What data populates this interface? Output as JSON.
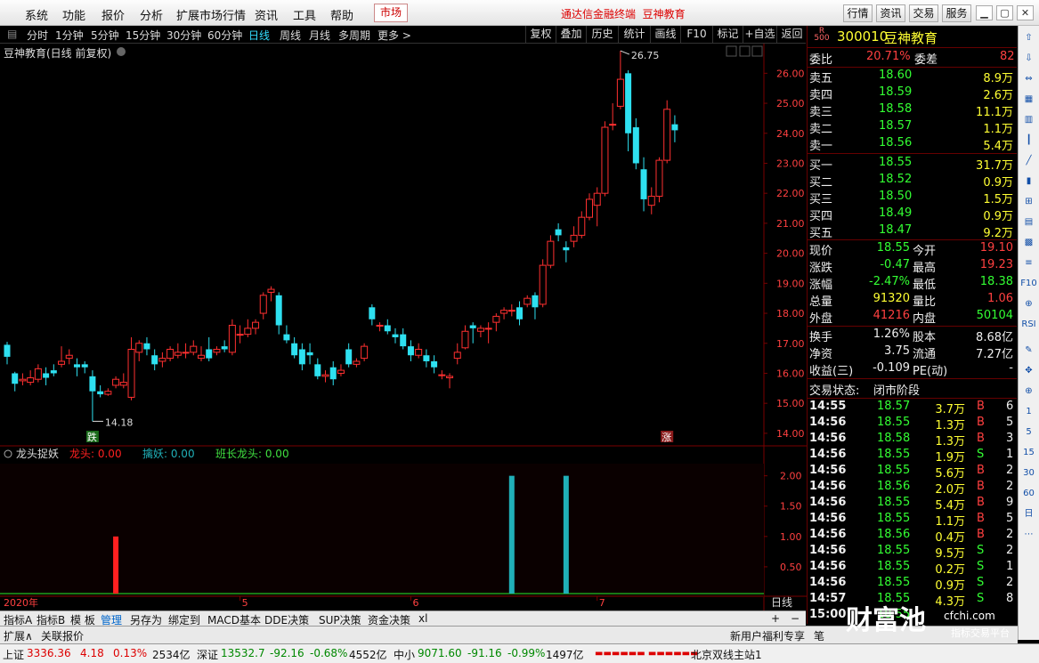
{
  "menubar": {
    "items": [
      "系统",
      "功能",
      "报价",
      "分析",
      "扩展市场行情",
      "资讯",
      "工具",
      "帮助"
    ],
    "market": "市场",
    "app_title": "通达信金融终端",
    "stock_title": "豆神教育",
    "right_buttons": [
      "行情",
      "资讯",
      "交易",
      "服务"
    ]
  },
  "periodbar": {
    "periods": [
      "分时",
      "1分钟",
      "5分钟",
      "15分钟",
      "30分钟",
      "60分钟",
      "日线",
      "周线",
      "月线",
      "多周期",
      "更多 >"
    ],
    "active": "日线",
    "tools": [
      "复权",
      "叠加",
      "历史",
      "统计",
      "画线",
      "F10",
      "标记",
      "+自选",
      "返回"
    ]
  },
  "chart_title": "豆神教育(日线 前复权)",
  "chart_data": [
    {
      "type": "candlestick",
      "title": "豆神教育(日线 前复权)",
      "y_ticks": [
        14.0,
        15.0,
        16.0,
        17.0,
        18.0,
        19.0,
        20.0,
        21.0,
        22.0,
        23.0,
        24.0,
        25.0,
        26.0
      ],
      "ylim": [
        13.7,
        26.9
      ],
      "x_labels": [
        "5",
        "6",
        "7"
      ],
      "high_label": "26.75",
      "low_label": "14.18",
      "markers": {
        "fall": "跌",
        "rise": "涨"
      },
      "candles": [
        [
          16.95,
          16.55,
          17.05,
          16.3
        ],
        [
          16.0,
          15.65,
          16.05,
          15.4
        ],
        [
          15.75,
          15.8,
          16.0,
          15.6
        ],
        [
          15.7,
          15.85,
          16.1,
          15.6
        ],
        [
          15.8,
          16.15,
          16.3,
          15.7
        ],
        [
          16.0,
          15.85,
          16.2,
          15.6
        ],
        [
          16.1,
          16.0,
          16.3,
          15.9
        ],
        [
          16.3,
          16.4,
          16.9,
          16.2
        ],
        [
          16.5,
          16.6,
          16.8,
          16.3
        ],
        [
          16.3,
          16.2,
          16.5,
          15.9
        ],
        [
          16.3,
          16.2,
          16.4,
          16.0
        ],
        [
          15.9,
          15.4,
          16.1,
          14.4
        ],
        [
          15.4,
          15.3,
          15.6,
          15.2
        ],
        [
          15.3,
          15.4,
          15.5,
          15.25
        ],
        [
          15.6,
          15.8,
          15.9,
          15.5
        ],
        [
          15.6,
          15.7,
          16.0,
          15.5
        ],
        [
          15.2,
          16.8,
          17.2,
          15.1
        ],
        [
          16.7,
          17.0,
          17.1,
          16.4
        ],
        [
          17.0,
          16.8,
          17.2,
          16.6
        ],
        [
          16.6,
          16.3,
          16.8,
          16.1
        ],
        [
          16.4,
          16.5,
          16.7,
          16.2
        ],
        [
          16.5,
          16.8,
          16.9,
          16.4
        ],
        [
          16.6,
          16.7,
          17.0,
          16.5
        ],
        [
          16.7,
          16.7,
          17.0,
          16.5
        ],
        [
          16.7,
          16.9,
          17.1,
          16.6
        ],
        [
          16.5,
          16.6,
          16.9,
          16.4
        ],
        [
          16.8,
          16.5,
          17.2,
          16.4
        ],
        [
          16.7,
          16.8,
          16.9,
          16.6
        ],
        [
          16.9,
          16.8,
          17.1,
          16.7
        ],
        [
          16.7,
          17.6,
          17.8,
          16.6
        ],
        [
          17.3,
          17.3,
          17.6,
          17.0
        ],
        [
          17.3,
          17.5,
          17.8,
          17.2
        ],
        [
          17.5,
          17.7,
          17.8,
          17.3
        ],
        [
          18.0,
          18.6,
          18.7,
          17.8
        ],
        [
          18.7,
          18.8,
          18.9,
          18.4
        ],
        [
          18.6,
          17.6,
          18.7,
          17.3
        ],
        [
          17.3,
          17.1,
          17.6,
          17.0
        ],
        [
          17.0,
          16.6,
          17.2,
          16.5
        ],
        [
          16.8,
          16.3,
          17.0,
          16.1
        ],
        [
          16.7,
          16.6,
          17.0,
          16.3
        ],
        [
          16.3,
          15.9,
          16.5,
          15.8
        ],
        [
          15.9,
          15.95,
          16.1,
          15.7
        ],
        [
          16.2,
          15.8,
          16.4,
          15.6
        ],
        [
          16.0,
          16.1,
          16.3,
          15.9
        ],
        [
          16.8,
          16.3,
          17.0,
          16.2
        ],
        [
          16.3,
          16.4,
          16.5,
          16.2
        ],
        [
          16.5,
          16.9,
          17.0,
          16.4
        ],
        [
          18.2,
          17.8,
          18.3,
          17.6
        ],
        [
          17.6,
          17.6,
          17.7,
          17.4
        ],
        [
          17.6,
          17.4,
          17.8,
          17.3
        ],
        [
          17.3,
          17.2,
          17.5,
          17.0
        ],
        [
          17.3,
          16.9,
          17.5,
          16.8
        ],
        [
          16.9,
          16.6,
          17.1,
          16.4
        ],
        [
          16.6,
          16.8,
          17.0,
          16.5
        ],
        [
          16.6,
          16.4,
          16.8,
          16.2
        ],
        [
          16.4,
          16.2,
          16.6,
          16.0
        ],
        [
          15.95,
          15.95,
          16.1,
          15.8
        ],
        [
          15.85,
          15.9,
          16.0,
          15.5
        ],
        [
          16.5,
          16.7,
          17.0,
          16.3
        ],
        [
          16.85,
          17.4,
          17.6,
          16.8
        ],
        [
          17.6,
          17.5,
          17.7,
          17.0
        ],
        [
          17.4,
          17.5,
          17.6,
          17.2
        ],
        [
          17.5,
          17.5,
          17.7,
          17.0
        ],
        [
          17.7,
          17.9,
          18.0,
          17.4
        ],
        [
          18.0,
          18.1,
          18.2,
          17.8
        ],
        [
          18.1,
          18.1,
          18.3,
          17.9
        ],
        [
          18.2,
          17.8,
          18.4,
          17.6
        ],
        [
          18.3,
          18.5,
          18.6,
          18.2
        ],
        [
          18.6,
          18.2,
          18.7,
          17.8
        ],
        [
          18.3,
          19.6,
          19.8,
          18.2
        ],
        [
          19.6,
          20.4,
          20.6,
          19.5
        ],
        [
          20.8,
          20.6,
          21.0,
          20.4
        ],
        [
          20.2,
          20.1,
          20.4,
          19.7
        ],
        [
          20.4,
          20.6,
          20.9,
          20.2
        ],
        [
          20.6,
          21.2,
          21.4,
          20.5
        ],
        [
          21.2,
          21.8,
          22.0,
          21.1
        ],
        [
          21.6,
          22.0,
          22.2,
          20.9
        ],
        [
          22.0,
          24.2,
          24.4,
          21.9
        ],
        [
          24.3,
          24.3,
          25.0,
          24.1
        ],
        [
          24.9,
          25.8,
          26.75,
          24.8
        ],
        [
          26.0,
          24.0,
          26.1,
          23.4
        ],
        [
          24.2,
          23.0,
          24.5,
          22.8
        ],
        [
          22.8,
          21.8,
          23.2,
          21.4
        ],
        [
          21.6,
          21.9,
          22.2,
          21.3
        ],
        [
          21.9,
          23.1,
          23.2,
          21.7
        ],
        [
          23.1,
          24.8,
          25.1,
          23.0
        ],
        [
          24.3,
          24.1,
          24.6,
          23.7
        ]
      ],
      "indicator": {
        "name": "龙头捉妖",
        "series": [
          {
            "name": "龙头",
            "value": "0.00",
            "color": "#ff2020"
          },
          {
            "name": "擒妖",
            "value": "0.00",
            "color": "#20b0b8"
          },
          {
            "name": "班长龙头",
            "value": "0.00",
            "color": "#40e040"
          }
        ],
        "y_ticks": [
          0.5,
          1.0,
          1.5,
          2.0
        ],
        "ylim": [
          0,
          2.2
        ],
        "bars": [
          {
            "series": "龙头",
            "index": 14,
            "value": 1.0
          },
          {
            "series": "擒妖",
            "index": 65,
            "value": 2.0
          },
          {
            "series": "擒妖",
            "index": 72,
            "value": 2.0
          }
        ]
      },
      "x_axis_label": "2020年",
      "period_label": "日线"
    }
  ],
  "quote": {
    "code": "300010",
    "name": "豆神教育",
    "wb_label": "委比",
    "wb_value": "20.71%",
    "wc_label": "委差",
    "wc_value": "82",
    "sells": [
      {
        "label": "卖五",
        "price": "18.60",
        "vol": "8.9万"
      },
      {
        "label": "卖四",
        "price": "18.59",
        "vol": "2.6万"
      },
      {
        "label": "卖三",
        "price": "18.58",
        "vol": "11.1万"
      },
      {
        "label": "卖二",
        "price": "18.57",
        "vol": "1.1万"
      },
      {
        "label": "卖一",
        "price": "18.56",
        "vol": "5.4万"
      }
    ],
    "buys": [
      {
        "label": "买一",
        "price": "18.55",
        "vol": "31.7万"
      },
      {
        "label": "买二",
        "price": "18.52",
        "vol": "0.9万"
      },
      {
        "label": "买三",
        "price": "18.50",
        "vol": "1.5万"
      },
      {
        "label": "买四",
        "price": "18.49",
        "vol": "0.9万"
      },
      {
        "label": "买五",
        "price": "18.47",
        "vol": "9.2万"
      }
    ],
    "stats": [
      {
        "l1": "现价",
        "v1": "18.55",
        "c1": "green",
        "l2": "今开",
        "v2": "19.10",
        "c2": "red"
      },
      {
        "l1": "涨跌",
        "v1": "-0.47",
        "c1": "green",
        "l2": "最高",
        "v2": "19.23",
        "c2": "red"
      },
      {
        "l1": "涨幅",
        "v1": "-2.47%",
        "c1": "green",
        "l2": "最低",
        "v2": "18.38",
        "c2": "green"
      },
      {
        "l1": "总量",
        "v1": "91320",
        "c1": "yellow",
        "l2": "量比",
        "v2": "1.06",
        "c2": "red"
      },
      {
        "l1": "外盘",
        "v1": "41216",
        "c1": "red",
        "l2": "内盘",
        "v2": "50104",
        "c2": "green"
      }
    ],
    "stats2": [
      {
        "l1": "换手",
        "v1": "1.26%",
        "l2": "股本",
        "v2": "8.68亿"
      },
      {
        "l1": "净资",
        "v1": "3.75",
        "l2": "流通",
        "v2": "7.27亿"
      },
      {
        "l1": "收益(三)",
        "v1": "-0.109",
        "l2": "PE(动)",
        "v2": "-"
      }
    ],
    "status_label": "交易状态:",
    "status_value": "闭市阶段",
    "ticks": [
      {
        "t": "14:55",
        "p": "18.57",
        "v": "3.7万",
        "bs": "B",
        "n": "6"
      },
      {
        "t": "14:56",
        "p": "18.55",
        "v": "1.3万",
        "bs": "B",
        "n": "5"
      },
      {
        "t": "14:56",
        "p": "18.58",
        "v": "1.3万",
        "bs": "B",
        "n": "3"
      },
      {
        "t": "14:56",
        "p": "18.55",
        "v": "1.9万",
        "bs": "S",
        "n": "1"
      },
      {
        "t": "14:56",
        "p": "18.55",
        "v": "5.6万",
        "bs": "B",
        "n": "2"
      },
      {
        "t": "14:56",
        "p": "18.56",
        "v": "2.0万",
        "bs": "B",
        "n": "2"
      },
      {
        "t": "14:56",
        "p": "18.55",
        "v": "5.4万",
        "bs": "B",
        "n": "9"
      },
      {
        "t": "14:56",
        "p": "18.55",
        "v": "1.1万",
        "bs": "B",
        "n": "5"
      },
      {
        "t": "14:56",
        "p": "18.56",
        "v": "0.4万",
        "bs": "B",
        "n": "2"
      },
      {
        "t": "14:56",
        "p": "18.55",
        "v": "9.5万",
        "bs": "S",
        "n": "2"
      },
      {
        "t": "14:56",
        "p": "18.55",
        "v": "0.2万",
        "bs": "S",
        "n": "1"
      },
      {
        "t": "14:56",
        "p": "18.55",
        "v": "0.9万",
        "bs": "S",
        "n": "2"
      },
      {
        "t": "14:57",
        "p": "18.55",
        "v": "4.3万",
        "bs": "S",
        "n": "8"
      },
      {
        "t": "15:00",
        "p": "18.55",
        "v": "",
        "bs": "",
        "n": ""
      }
    ]
  },
  "tabs": [
    "指标A",
    "指标B",
    "模 板",
    "管理",
    "另存为",
    "绑定到",
    "MACD基本",
    "DDE决策",
    "SUP决策",
    "资金决策",
    "xl"
  ],
  "tabs_active": "管理",
  "bottom": {
    "left1": "扩展∧",
    "left2": "关联报价",
    "right1": "新用户福利专享",
    "right2": "笔"
  },
  "status": {
    "sh_label": "上证",
    "sh_value": "3336.36",
    "sh_chg": "4.18",
    "sh_pct": "0.13%",
    "sh_amt": "2534亿",
    "sz_label": "深证",
    "sz_value": "13532.7",
    "sz_chg": "-92.16",
    "sz_pct": "-0.68%",
    "sz_amt": "4552亿",
    "zx_label": "中小",
    "zx_value": "9071.60",
    "zx_chg": "-91.16",
    "zx_pct": "-0.99%",
    "zx_amt": "1497亿",
    "bj": "北京双线主站1"
  },
  "watermark": {
    "main": "财富池",
    "url": "cfchi.com",
    "sub": "指标交易平台"
  },
  "colors": {
    "up": "#ff3030",
    "down": "#2ee0f0",
    "bg": "#000000",
    "grid": "#7a0000"
  }
}
